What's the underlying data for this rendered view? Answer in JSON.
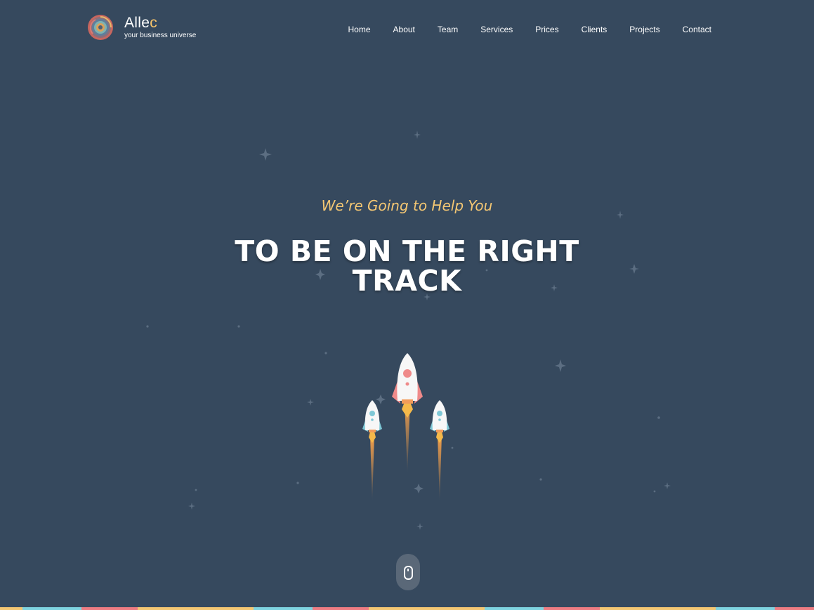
{
  "brand": {
    "name_main": "Alle",
    "name_accent": "c",
    "tagline": "your business universe",
    "accent_color": "#f9c56a"
  },
  "nav": {
    "items": [
      "Home",
      "About",
      "Team",
      "Services",
      "Prices",
      "Clients",
      "Projects",
      "Contact"
    ]
  },
  "hero": {
    "subtitle": "We’re Going to Help You",
    "title_line1": "TO BE ON THE RIGHT",
    "title_line2": "TRACK",
    "subtitle_color": "#f4c773"
  },
  "scroll": {
    "icon": "mouse-scroll-icon"
  },
  "colors": {
    "background": "#36495e",
    "bar_palette": [
      "#f4c773",
      "#7fd3e0",
      "#ee7c82",
      "#f4c773",
      "#7fd3e0",
      "#ee7c82",
      "#f4c773",
      "#7fd3e0",
      "#ee7c82",
      "#f4c773",
      "#7fd3e0",
      "#ee7c82"
    ]
  }
}
